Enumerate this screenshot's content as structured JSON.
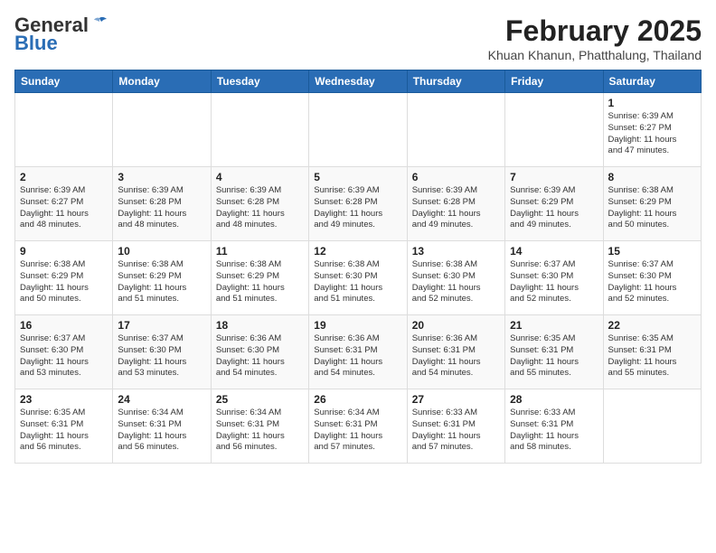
{
  "header": {
    "logo_general": "General",
    "logo_blue": "Blue",
    "month_year": "February 2025",
    "location": "Khuan Khanun, Phatthalung, Thailand"
  },
  "days_of_week": [
    "Sunday",
    "Monday",
    "Tuesday",
    "Wednesday",
    "Thursday",
    "Friday",
    "Saturday"
  ],
  "weeks": [
    [
      {
        "day": "",
        "info": ""
      },
      {
        "day": "",
        "info": ""
      },
      {
        "day": "",
        "info": ""
      },
      {
        "day": "",
        "info": ""
      },
      {
        "day": "",
        "info": ""
      },
      {
        "day": "",
        "info": ""
      },
      {
        "day": "1",
        "info": "Sunrise: 6:39 AM\nSunset: 6:27 PM\nDaylight: 11 hours\nand 47 minutes."
      }
    ],
    [
      {
        "day": "2",
        "info": "Sunrise: 6:39 AM\nSunset: 6:27 PM\nDaylight: 11 hours\nand 48 minutes."
      },
      {
        "day": "3",
        "info": "Sunrise: 6:39 AM\nSunset: 6:28 PM\nDaylight: 11 hours\nand 48 minutes."
      },
      {
        "day": "4",
        "info": "Sunrise: 6:39 AM\nSunset: 6:28 PM\nDaylight: 11 hours\nand 48 minutes."
      },
      {
        "day": "5",
        "info": "Sunrise: 6:39 AM\nSunset: 6:28 PM\nDaylight: 11 hours\nand 49 minutes."
      },
      {
        "day": "6",
        "info": "Sunrise: 6:39 AM\nSunset: 6:28 PM\nDaylight: 11 hours\nand 49 minutes."
      },
      {
        "day": "7",
        "info": "Sunrise: 6:39 AM\nSunset: 6:29 PM\nDaylight: 11 hours\nand 49 minutes."
      },
      {
        "day": "8",
        "info": "Sunrise: 6:38 AM\nSunset: 6:29 PM\nDaylight: 11 hours\nand 50 minutes."
      }
    ],
    [
      {
        "day": "9",
        "info": "Sunrise: 6:38 AM\nSunset: 6:29 PM\nDaylight: 11 hours\nand 50 minutes."
      },
      {
        "day": "10",
        "info": "Sunrise: 6:38 AM\nSunset: 6:29 PM\nDaylight: 11 hours\nand 51 minutes."
      },
      {
        "day": "11",
        "info": "Sunrise: 6:38 AM\nSunset: 6:29 PM\nDaylight: 11 hours\nand 51 minutes."
      },
      {
        "day": "12",
        "info": "Sunrise: 6:38 AM\nSunset: 6:30 PM\nDaylight: 11 hours\nand 51 minutes."
      },
      {
        "day": "13",
        "info": "Sunrise: 6:38 AM\nSunset: 6:30 PM\nDaylight: 11 hours\nand 52 minutes."
      },
      {
        "day": "14",
        "info": "Sunrise: 6:37 AM\nSunset: 6:30 PM\nDaylight: 11 hours\nand 52 minutes."
      },
      {
        "day": "15",
        "info": "Sunrise: 6:37 AM\nSunset: 6:30 PM\nDaylight: 11 hours\nand 52 minutes."
      }
    ],
    [
      {
        "day": "16",
        "info": "Sunrise: 6:37 AM\nSunset: 6:30 PM\nDaylight: 11 hours\nand 53 minutes."
      },
      {
        "day": "17",
        "info": "Sunrise: 6:37 AM\nSunset: 6:30 PM\nDaylight: 11 hours\nand 53 minutes."
      },
      {
        "day": "18",
        "info": "Sunrise: 6:36 AM\nSunset: 6:30 PM\nDaylight: 11 hours\nand 54 minutes."
      },
      {
        "day": "19",
        "info": "Sunrise: 6:36 AM\nSunset: 6:31 PM\nDaylight: 11 hours\nand 54 minutes."
      },
      {
        "day": "20",
        "info": "Sunrise: 6:36 AM\nSunset: 6:31 PM\nDaylight: 11 hours\nand 54 minutes."
      },
      {
        "day": "21",
        "info": "Sunrise: 6:35 AM\nSunset: 6:31 PM\nDaylight: 11 hours\nand 55 minutes."
      },
      {
        "day": "22",
        "info": "Sunrise: 6:35 AM\nSunset: 6:31 PM\nDaylight: 11 hours\nand 55 minutes."
      }
    ],
    [
      {
        "day": "23",
        "info": "Sunrise: 6:35 AM\nSunset: 6:31 PM\nDaylight: 11 hours\nand 56 minutes."
      },
      {
        "day": "24",
        "info": "Sunrise: 6:34 AM\nSunset: 6:31 PM\nDaylight: 11 hours\nand 56 minutes."
      },
      {
        "day": "25",
        "info": "Sunrise: 6:34 AM\nSunset: 6:31 PM\nDaylight: 11 hours\nand 56 minutes."
      },
      {
        "day": "26",
        "info": "Sunrise: 6:34 AM\nSunset: 6:31 PM\nDaylight: 11 hours\nand 57 minutes."
      },
      {
        "day": "27",
        "info": "Sunrise: 6:33 AM\nSunset: 6:31 PM\nDaylight: 11 hours\nand 57 minutes."
      },
      {
        "day": "28",
        "info": "Sunrise: 6:33 AM\nSunset: 6:31 PM\nDaylight: 11 hours\nand 58 minutes."
      },
      {
        "day": "",
        "info": ""
      }
    ]
  ]
}
